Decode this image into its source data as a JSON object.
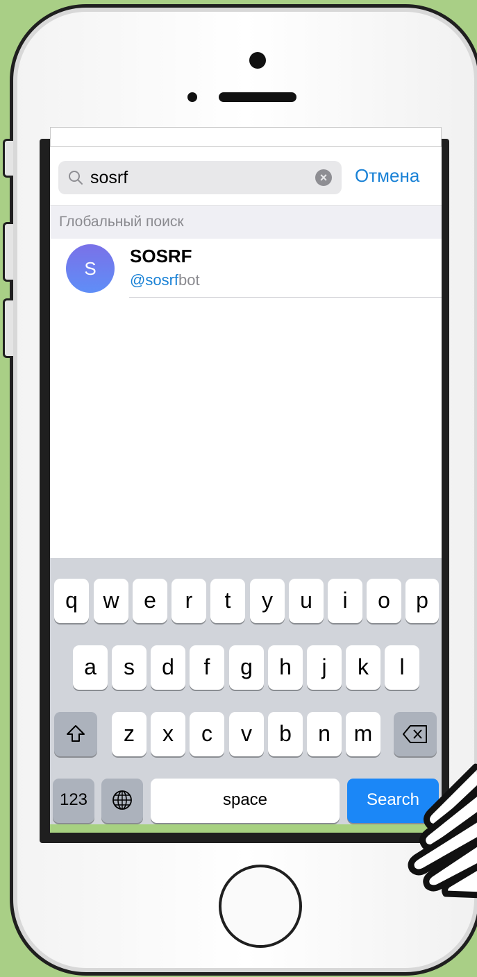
{
  "search": {
    "query": "sosrf",
    "cancel_label": "Отмена"
  },
  "section": {
    "title": "Глобальный поиск"
  },
  "results": [
    {
      "avatar_letter": "S",
      "name": "SOSRF",
      "handle_match": "@sosrf",
      "handle_rest": "bot"
    }
  ],
  "keyboard": {
    "row1": [
      "q",
      "w",
      "e",
      "r",
      "t",
      "y",
      "u",
      "i",
      "o",
      "p"
    ],
    "row2": [
      "a",
      "s",
      "d",
      "f",
      "g",
      "h",
      "j",
      "k",
      "l"
    ],
    "row3": [
      "z",
      "x",
      "c",
      "v",
      "b",
      "n",
      "m"
    ],
    "numbers_label": "123",
    "space_label": "space",
    "search_label": "Search",
    "shift_icon": "shift-icon",
    "delete_icon": "delete-icon",
    "globe_icon": "globe-icon"
  },
  "colors": {
    "accent": "#1a82d6",
    "search_key": "#1b87f7",
    "background": "#a9cf86"
  }
}
